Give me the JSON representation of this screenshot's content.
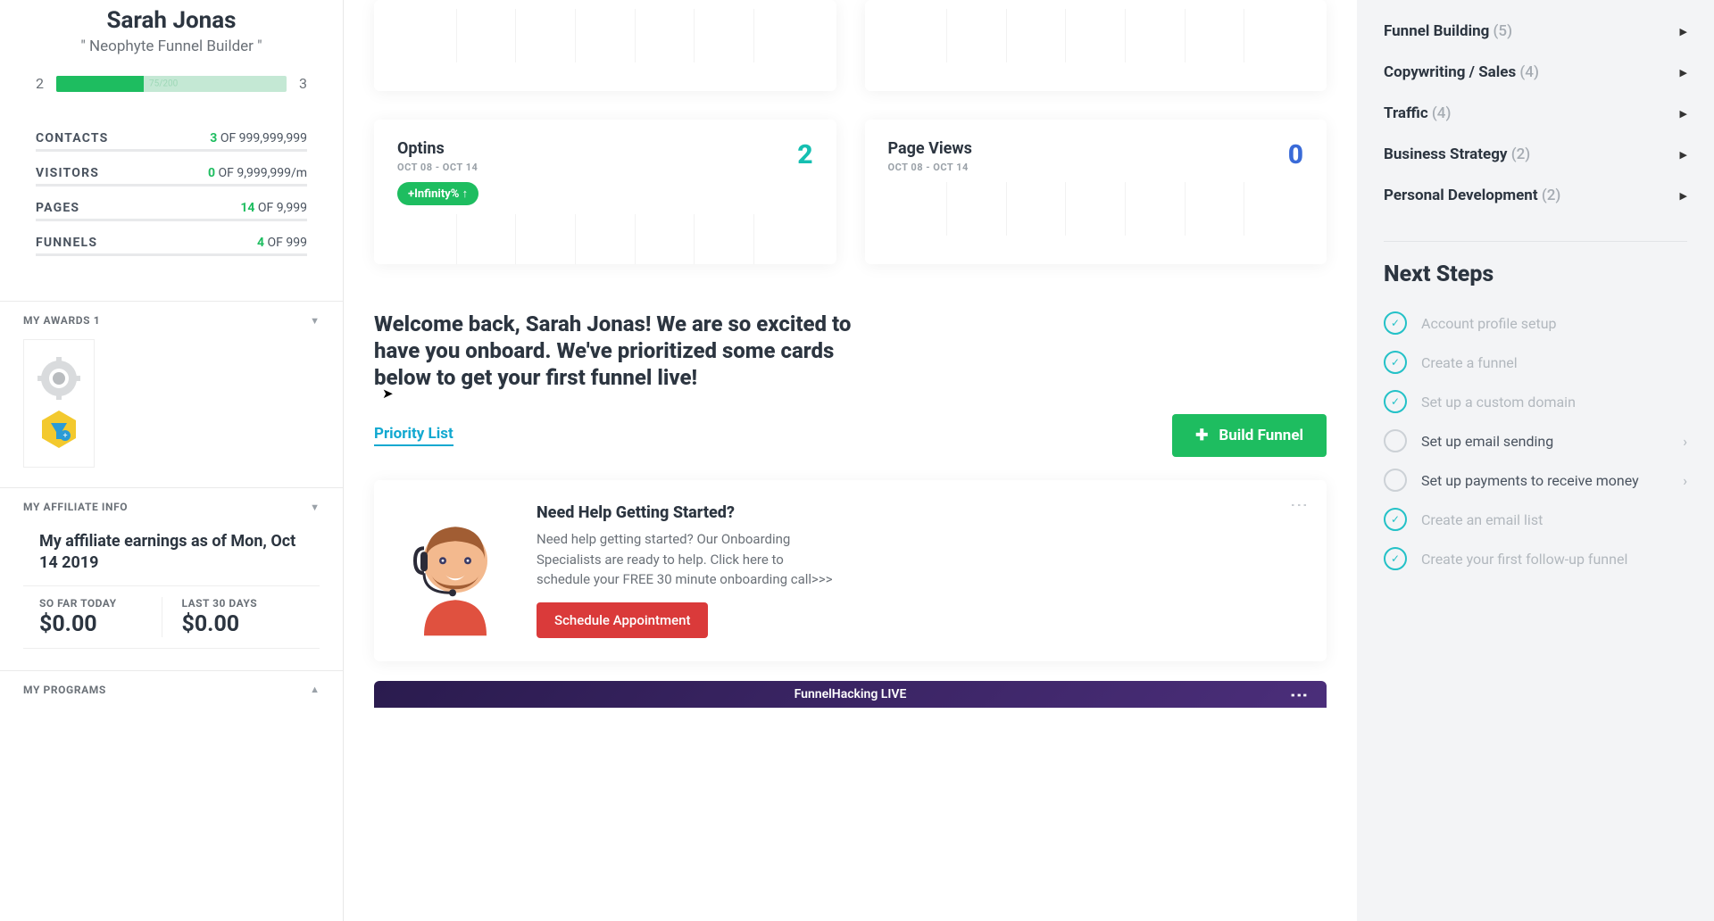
{
  "profile": {
    "name": "Sarah Jonas",
    "subtitle": "\" Neophyte Funnel Builder \"",
    "level_current": "2",
    "level_next": "3",
    "progress_label": "75/200"
  },
  "stats": {
    "contacts": {
      "label": "CONTACTS",
      "count": "3",
      "of": " OF ",
      "max": "999,999,999"
    },
    "visitors": {
      "label": "VISITORS",
      "count": "0",
      "of": " OF ",
      "max": "9,999,999/m"
    },
    "pages": {
      "label": "PAGES",
      "count": "14",
      "of": " OF ",
      "max": "9,999"
    },
    "funnels": {
      "label": "FUNNELS",
      "count": "4",
      "of": " OF ",
      "max": "999"
    }
  },
  "awards": {
    "title": "MY AWARDS 1"
  },
  "affiliate": {
    "title": "MY AFFILIATE INFO",
    "heading": "My affiliate earnings as of Mon, Oct 14 2019",
    "today_label": "SO FAR TODAY",
    "today_amount": "$0.00",
    "last30_label": "LAST 30 DAYS",
    "last30_amount": "$0.00"
  },
  "programs": {
    "title": "MY PROGRAMS"
  },
  "metrics": {
    "optins": {
      "name": "Optins",
      "date": "OCT 08 - OCT 14",
      "value": "2",
      "badge": "+Infinity% ↑"
    },
    "pageviews": {
      "name": "Page Views",
      "date": "OCT 08 - OCT 14",
      "value": "0"
    }
  },
  "welcome": {
    "title": "Welcome back, Sarah Jonas! We are so excited to have you onboard. We've prioritized some cards below to get your first funnel live!",
    "priority": "Priority List",
    "build": "Build Funnel"
  },
  "help": {
    "title": "Need Help Getting Started?",
    "body": "Need help getting started? Our Onboarding Specialists are ready to help. Click here to schedule your FREE 30 minute onboarding call>>>",
    "cta": "Schedule Appointment"
  },
  "funnel_hacking": {
    "label": "FunnelHacking LIVE"
  },
  "categories": [
    {
      "name": "Funnel Building",
      "count": "(5)"
    },
    {
      "name": "Copywriting / Sales",
      "count": "(4)"
    },
    {
      "name": "Traffic",
      "count": "(4)"
    },
    {
      "name": "Business Strategy",
      "count": "(2)"
    },
    {
      "name": "Personal Development",
      "count": "(2)"
    }
  ],
  "next_steps": {
    "title": "Next Steps",
    "items": [
      {
        "label": "Account profile setup",
        "done": true,
        "arrow": false
      },
      {
        "label": "Create a funnel",
        "done": true,
        "arrow": false
      },
      {
        "label": "Set up a custom domain",
        "done": true,
        "arrow": false
      },
      {
        "label": "Set up email sending",
        "done": false,
        "arrow": true
      },
      {
        "label": "Set up payments to receive money",
        "done": false,
        "arrow": true
      },
      {
        "label": "Create an email list",
        "done": true,
        "arrow": false
      },
      {
        "label": "Create your first follow-up funnel",
        "done": true,
        "arrow": false
      }
    ]
  }
}
